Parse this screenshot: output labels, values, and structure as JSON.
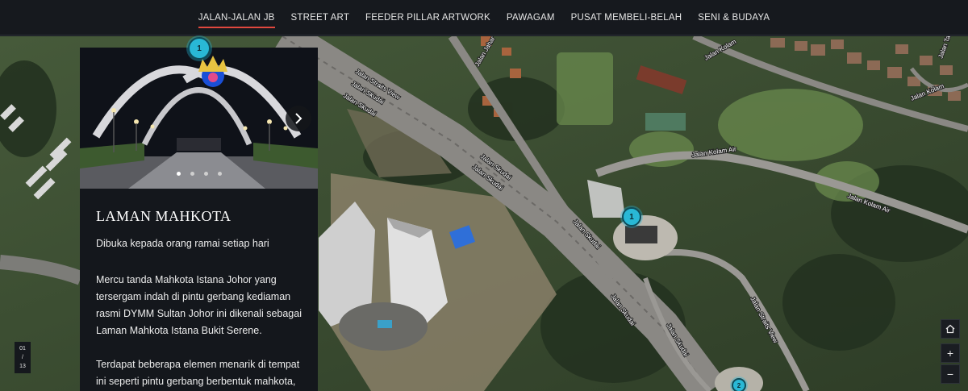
{
  "nav": {
    "items": [
      {
        "label": "JALAN-JALAN JB",
        "active": true
      },
      {
        "label": "STREET ART",
        "active": false
      },
      {
        "label": "FEEDER PILLAR ARTWORK",
        "active": false
      },
      {
        "label": "PAWAGAM",
        "active": false
      },
      {
        "label": "PUSAT MEMBELI-BELAH",
        "active": false
      },
      {
        "label": "SENI & BUDAYA",
        "active": false
      }
    ],
    "accent": "#e0483e"
  },
  "map": {
    "road_labels": {
      "straits_view_1": "Jalan Straits View",
      "straits_view_2": "Jalan Straits View",
      "skudai_1": "Jalan Skudai",
      "skudai_2": "Jalan Skudai",
      "skudai_3": "Jalan Skudai",
      "skudai_4": "Jalan Skudai",
      "skudai_5": "Jalan Skudai",
      "skudai_6": "Jalan Skudai",
      "skudai_7": "Jalan Skudai",
      "kolam_1": "Jalan Kolam",
      "kolam_2": "Jalan Kolam",
      "kolam_air_1": "Jalan Kolam Air",
      "kolam_air_2": "Jalan Kolam Air",
      "straits_view_3": "Jalan Straits View",
      "jahar": "Jalan Jahar",
      "tasek": "Jalan Tasek"
    },
    "markers": {
      "m1_top": "1",
      "m1_map": "1",
      "m2": "2"
    },
    "marker_color": "#29b8d6"
  },
  "panel": {
    "title": "LAMAN MAHKOTA",
    "subtitle": "Dibuka kepada orang ramai setiap hari",
    "paragraph1": "Mercu tanda Mahkota Istana Johor yang tersergam indah di pintu gerbang kediaman rasmi DYMM Sultan Johor ini dikenali sebagai Laman Mahkota Istana Bukit Serene.",
    "paragraph2": "Terdapat beberapa elemen menarik di tempat ini seperti pintu gerbang berbentuk mahkota, air pancut berwarna-warni serta",
    "slide_count": 4,
    "slide_active": 0,
    "next_icon": "chevron-right-icon"
  },
  "counter": {
    "current": "01",
    "sep": "/",
    "total": "13"
  },
  "controls": {
    "home_icon": "home-icon",
    "zoom_in": "+",
    "zoom_out": "−"
  }
}
